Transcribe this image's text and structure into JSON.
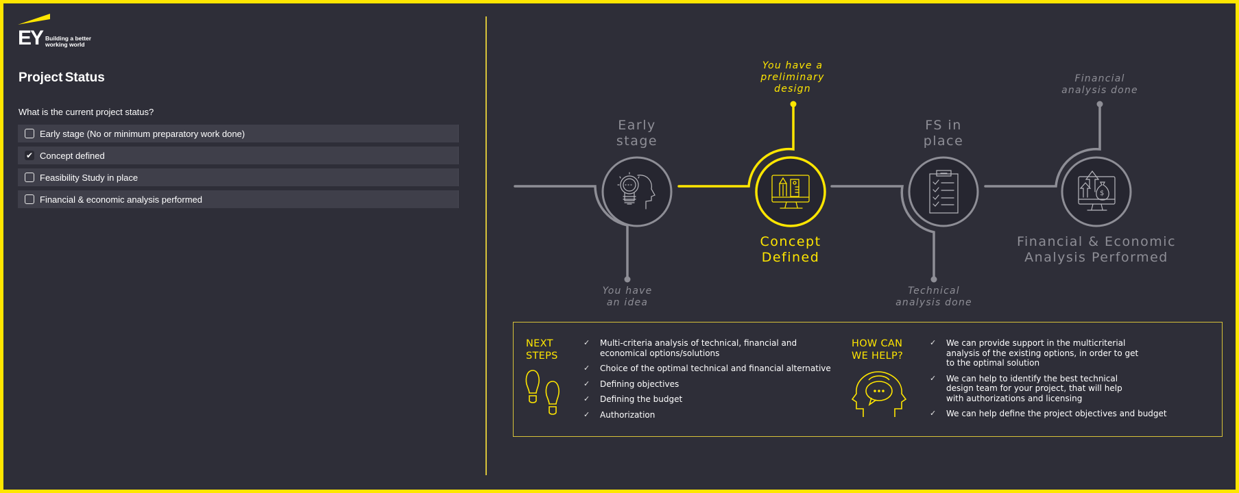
{
  "brand": {
    "logo_text": "EY",
    "tagline": "Building a better\nworking world",
    "accent_color": "#ffe600",
    "background_color": "#2e2e38",
    "muted_color": "#8e8e96"
  },
  "left_panel": {
    "title": "Project Status",
    "question": "What is the current project status?",
    "options": [
      {
        "label": "Early stage (No or minimum preparatory  work done)",
        "checked": false
      },
      {
        "label": "Concept  defined",
        "checked": true
      },
      {
        "label": "Feasibility Study in place",
        "checked": false
      },
      {
        "label": "Financial  & economic  analysis  performed",
        "checked": false
      }
    ]
  },
  "timeline": {
    "active_stage": 1,
    "stages": [
      {
        "title": "Early\nstage",
        "icon": "lightbulb-head-icon",
        "milestone": "You have\nan idea",
        "milestone_position": "below"
      },
      {
        "title": "Concept\nDefined",
        "icon": "monitor-design-icon",
        "milestone": "You have a\npreliminary\ndesign",
        "milestone_position": "above"
      },
      {
        "title": "FS in\nplace",
        "icon": "clipboard-checklist-icon",
        "milestone": "Technical\nanalysis done",
        "milestone_position": "below"
      },
      {
        "title": "Financial & Economic\nAnalysis Performed",
        "icon": "monitor-money-growth-icon",
        "milestone": "Financial\nanalysis done",
        "milestone_position": "above"
      }
    ]
  },
  "next_steps": {
    "heading": "NEXT\nSTEPS",
    "icon": "footprints-icon",
    "items": [
      "Multi-criteria  analysis of technical,  financial  and\neconomical  options/solutions",
      "Choice  of the optimal technical  and financial  alternative",
      "Defining  objectives",
      "Defining  the budget",
      "Authorization"
    ]
  },
  "how_can_we_help": {
    "heading": "HOW CAN\nWE HELP?",
    "icon": "two-heads-speech-icon",
    "items": [
      "We can provide  support  in the multicriterial\nanalysis of the existing  options,  in order  to get\nto the optimal  solution",
      "We can help to identify the best technical\ndesign  team for your project,  that will help\nwith authorizations  and licensing",
      "We can help define the project  objectives  and budget"
    ]
  }
}
